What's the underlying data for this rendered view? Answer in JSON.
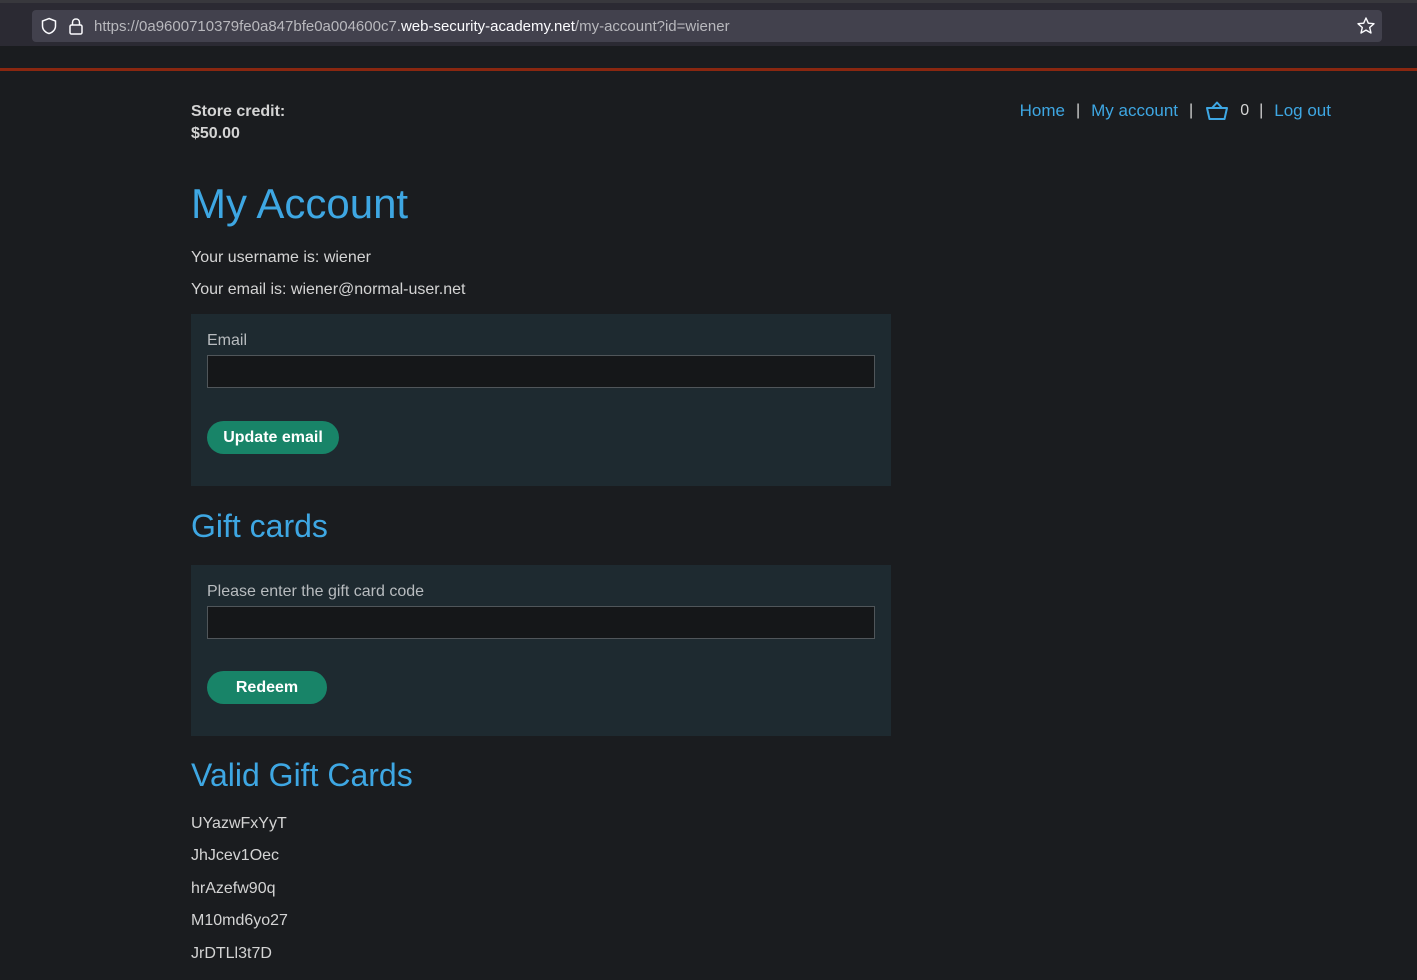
{
  "browser": {
    "url_prefix": "https://0a9600710379fe0a847bfe0a004600c7.",
    "url_domain": "web-security-academy.net",
    "url_path": "/my-account?id=wiener"
  },
  "header": {
    "store_credit_label": "Store credit:",
    "store_credit_value": "$50.00",
    "nav": {
      "home": "Home",
      "my_account": "My account",
      "cart_count": "0",
      "logout": "Log out",
      "separator": "|"
    }
  },
  "account": {
    "title": "My Account",
    "username_line": "Your username is: wiener",
    "email_line": "Your email is: wiener@normal-user.net",
    "email_form": {
      "label": "Email",
      "value": "",
      "button": "Update email"
    }
  },
  "gift_cards": {
    "title": "Gift cards",
    "label": "Please enter the gift card code",
    "value": "",
    "button": "Redeem"
  },
  "valid_cards": {
    "title": "Valid Gift Cards",
    "codes": [
      "UYazwFxYyT",
      "JhJcev1Oec",
      "hrAzefw90q",
      "M10md6yo27",
      "JrDTLl3t7D"
    ]
  },
  "colors": {
    "accent": "#3ea7e3",
    "button": "#188468",
    "background": "#1a1c1f",
    "panel": "#1e2a30",
    "top_line": "#8a2710"
  }
}
